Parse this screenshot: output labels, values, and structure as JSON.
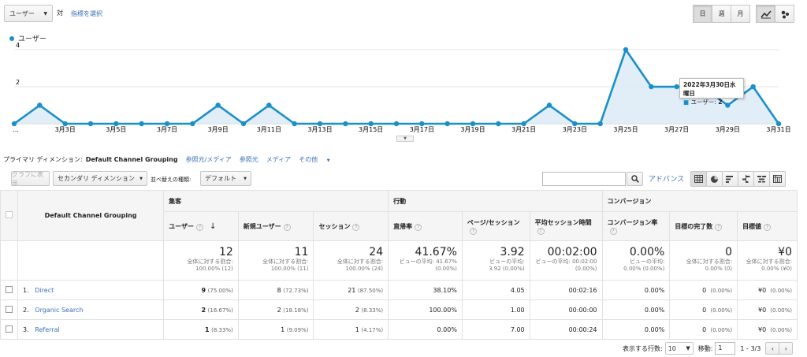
{
  "top": {
    "metric_select": "ユーザー",
    "vs": "対",
    "select_metric_link": "指標を選択",
    "periods": [
      "日",
      "週",
      "月"
    ],
    "active_period": "日"
  },
  "legend": {
    "label": "ユーザー",
    "color": "#1a8fc9"
  },
  "chart_data": {
    "type": "area",
    "x": [
      "3月1日",
      "3月2日",
      "3月3日",
      "3月4日",
      "3月5日",
      "3月6日",
      "3月7日",
      "3月8日",
      "3月9日",
      "3月10日",
      "3月11日",
      "3月12日",
      "3月13日",
      "3月14日",
      "3月15日",
      "3月16日",
      "3月17日",
      "3月18日",
      "3月19日",
      "3月20日",
      "3月21日",
      "3月22日",
      "3月23日",
      "3月24日",
      "3月25日",
      "3月26日",
      "3月27日",
      "3月28日",
      "3月29日",
      "3月30日",
      "3月31日"
    ],
    "series": [
      {
        "name": "ユーザー",
        "values": [
          0,
          1,
          0,
          0,
          0,
          0,
          0,
          0,
          1,
          0,
          1,
          0,
          0,
          0,
          0,
          0,
          0,
          0,
          0,
          0,
          0,
          1,
          0,
          0,
          4,
          2,
          2,
          2,
          1,
          2,
          0
        ]
      }
    ],
    "yticks": [
      "2",
      "4"
    ],
    "ylim": [
      0,
      4.3
    ],
    "xtick_labels": [
      "...",
      "3月3日",
      "3月5日",
      "3月7日",
      "3月9日",
      "3月11日",
      "3月13日",
      "3月15日",
      "3月17日",
      "3月19日",
      "3月21日",
      "3月23日",
      "3月25日",
      "3月27日",
      "3月29日",
      "3月31日"
    ],
    "tooltip": {
      "date": "2022年3月30日水曜日",
      "label": "ユーザー: ",
      "value": "2"
    }
  },
  "dimensions": {
    "prefix": "プライマリ ディメンション:",
    "active": "Default Channel Grouping",
    "others": [
      "参照元/メディア",
      "参照元",
      "メディア",
      "その他"
    ]
  },
  "toolbar": {
    "graph_button": "グラフに表示",
    "secondary_dim": "セカンダリ ディメンション",
    "sort_label": "並べ替えの種類:",
    "sort_value": "デフォルト",
    "advanced": "アドバンス"
  },
  "table": {
    "dim_header": "Default Channel Grouping",
    "groups": [
      "集客",
      "行動",
      "コンバージョン"
    ],
    "metrics": [
      "ユーザー",
      "新規ユーザー",
      "セッション",
      "直帰率",
      "ページ/セッション",
      "平均セッション時間",
      "コンバージョン率",
      "目標の完了数",
      "目標値"
    ],
    "totals": [
      {
        "value": "12",
        "sub1": "全体に対する割合:",
        "sub2": "100.00% (12)"
      },
      {
        "value": "11",
        "sub1": "全体に対する割合:",
        "sub2": "100.00% (11)"
      },
      {
        "value": "24",
        "sub1": "全体に対する割合:",
        "sub2": "100.00% (24)"
      },
      {
        "value": "41.67%",
        "sub1": "ビューの平均: 41.67%",
        "sub2": "(0.00%)"
      },
      {
        "value": "3.92",
        "sub1": "ビューの平均:",
        "sub2": "3.92 (0.00%)"
      },
      {
        "value": "00:02:00",
        "sub1": "ビューの平均: 00:02:00",
        "sub2": "(0.00%)"
      },
      {
        "value": "0.00%",
        "sub1": "ビューの平均:",
        "sub2": "0.00% (0.00%)"
      },
      {
        "value": "0",
        "sub1": "全体に対する割合:",
        "sub2": "0.00% (0)"
      },
      {
        "value": "¥0",
        "sub1": "全体に対する割合:",
        "sub2": "0.00% (¥0)"
      }
    ],
    "rows": [
      {
        "idx": "1.",
        "name": "Direct",
        "users": "9",
        "users_pct": "(75.00%)",
        "new": "8",
        "new_pct": "(72.73%)",
        "sess": "21",
        "sess_pct": "(87.50%)",
        "bounce": "38.10%",
        "pps": "4.05",
        "dur": "00:02:16",
        "cr": "0.00%",
        "goal": "0",
        "goal_pct": "(0.00%)",
        "gv": "¥0",
        "gv_pct": "(0.00%)"
      },
      {
        "idx": "2.",
        "name": "Organic Search",
        "users": "2",
        "users_pct": "(16.67%)",
        "new": "2",
        "new_pct": "(18.18%)",
        "sess": "2",
        "sess_pct": "(8.33%)",
        "bounce": "100.00%",
        "pps": "1.00",
        "dur": "00:00:00",
        "cr": "0.00%",
        "goal": "0",
        "goal_pct": "(0.00%)",
        "gv": "¥0",
        "gv_pct": "(0.00%)"
      },
      {
        "idx": "3.",
        "name": "Referral",
        "users": "1",
        "users_pct": "(8.33%)",
        "new": "1",
        "new_pct": "(9.09%)",
        "sess": "1",
        "sess_pct": "(4.17%)",
        "bounce": "0.00%",
        "pps": "7.00",
        "dur": "00:00:24",
        "cr": "0.00%",
        "goal": "0",
        "goal_pct": "(0.00%)",
        "gv": "¥0",
        "gv_pct": "(0.00%)"
      }
    ]
  },
  "pager": {
    "rows_label": "表示する行数:",
    "rows_value": "10",
    "goto_label": "移動:",
    "goto_value": "1",
    "range": "1 - 3/3"
  }
}
